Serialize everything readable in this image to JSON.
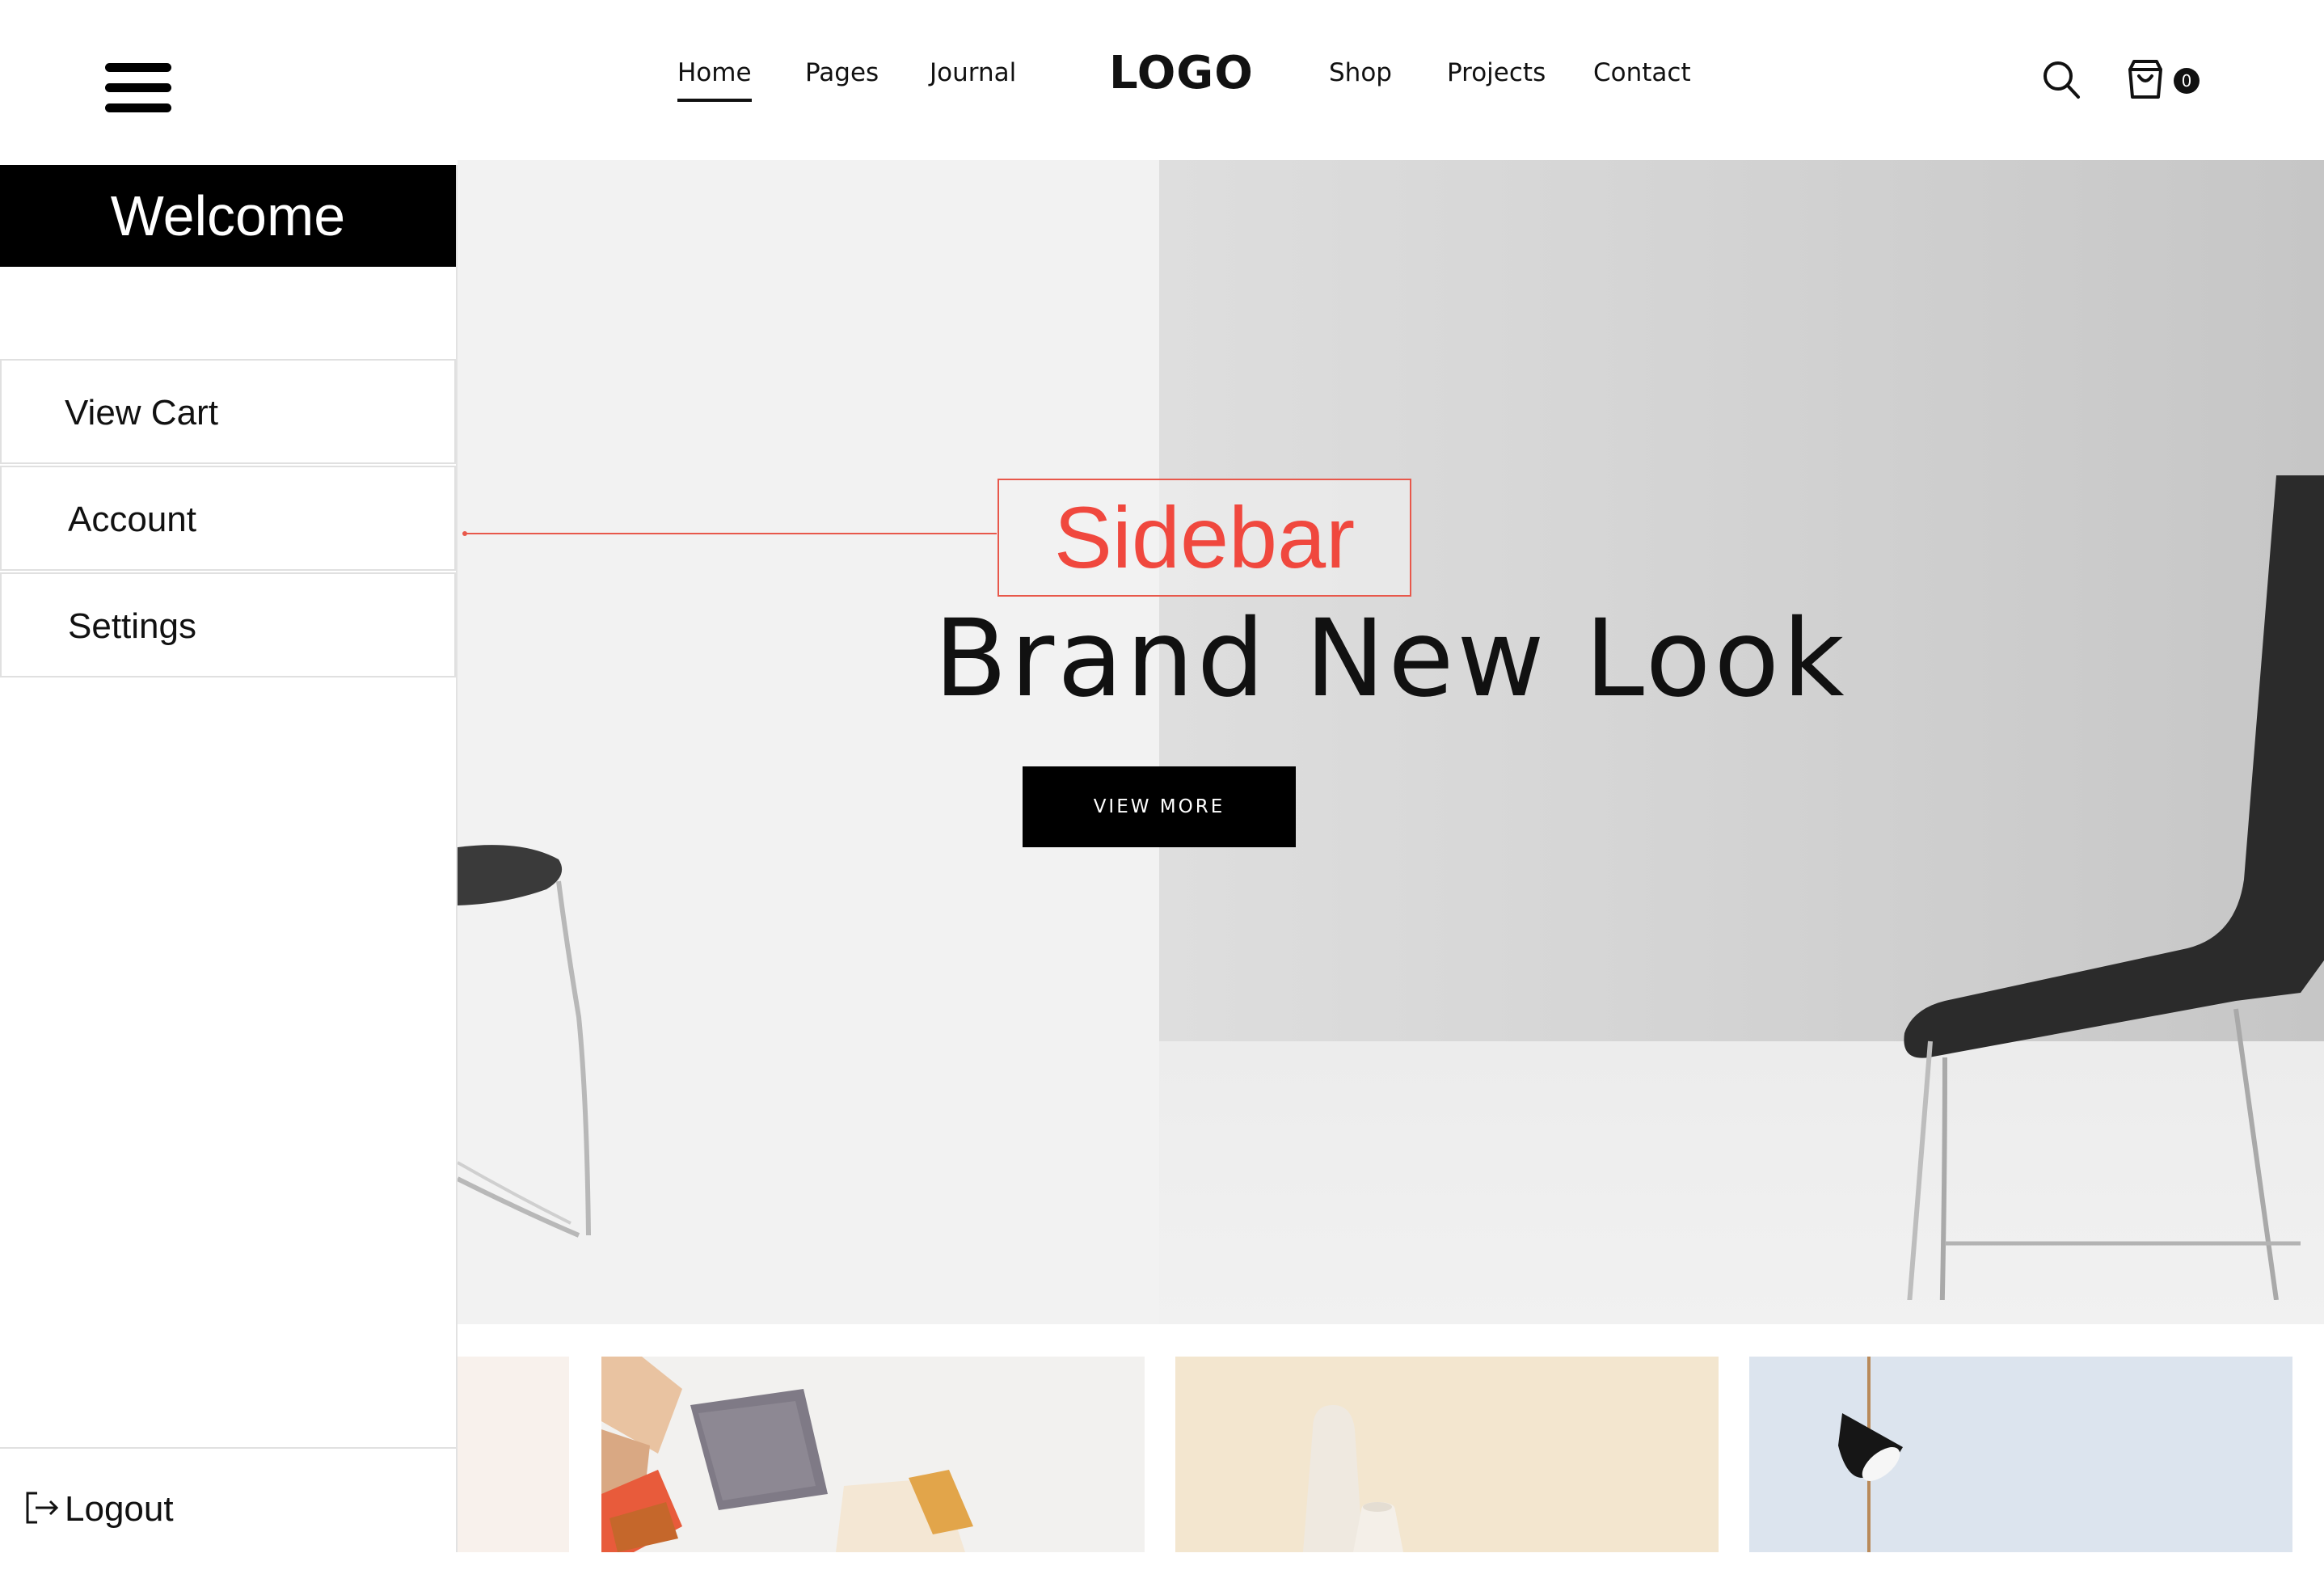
{
  "header": {
    "logo": "LOGO",
    "nav_left": [
      "Home",
      "Pages",
      "Journal"
    ],
    "nav_right": [
      "Shop",
      "Projects",
      "Contact"
    ],
    "active_nav": "Home",
    "cart_count": "0",
    "icons": {
      "menu": "hamburger-icon",
      "search": "search-icon",
      "cart": "shopping-bag-icon"
    }
  },
  "sidebar": {
    "title": "Welcome",
    "items": [
      {
        "label": "View Cart"
      },
      {
        "label": "Account"
      },
      {
        "label": "Settings"
      }
    ],
    "logout": {
      "label": "Logout",
      "icon": "logout-icon"
    }
  },
  "annotation": {
    "label": "Sidebar",
    "color": "#f0483e"
  },
  "hero": {
    "title": "Brand New Look",
    "button": "VIEW MORE"
  },
  "products": [
    {
      "name": "product-card-partial"
    },
    {
      "name": "product-card-soaps"
    },
    {
      "name": "product-card-vases"
    },
    {
      "name": "product-card-lamp"
    }
  ],
  "colors": {
    "accent": "#000000",
    "annotation": "#f0483e",
    "hero_bg": "#f2f2f2"
  }
}
